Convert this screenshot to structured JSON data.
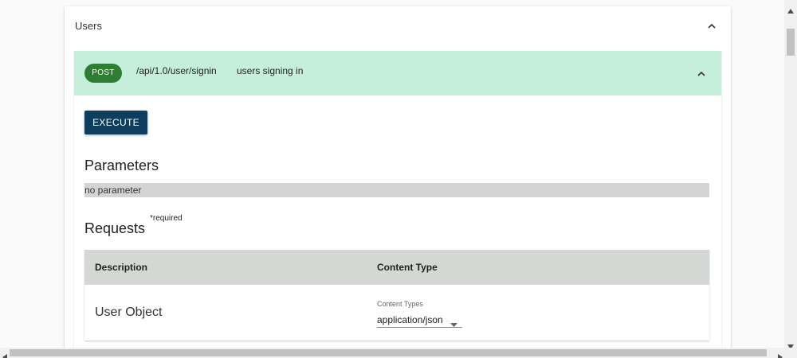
{
  "tag": {
    "title": "Users",
    "chevron_icon": "chevron-up-icon"
  },
  "operation": {
    "method": "POST",
    "path": "/api/1.0/user/signin",
    "summary": "users signing in",
    "method_color": "#2e7d32",
    "summary_background": "#c5eedb",
    "execute_label": "EXECUTE",
    "execute_color": "#0e3e5e"
  },
  "parameters": {
    "title": "Parameters",
    "empty_text": "no parameter"
  },
  "requests": {
    "title": "Requests",
    "required_note": "*required",
    "columns": [
      "Description",
      "Content Type"
    ],
    "rows": [
      {
        "description": "User Object",
        "content_type_label": "Content Types",
        "content_type_value": "application/json"
      }
    ]
  },
  "scrollbars": {
    "up_icon": "scroll-up-arrow-icon",
    "down_icon": "scroll-down-arrow-icon",
    "left_icon": "scroll-left-arrow-icon",
    "right_icon": "scroll-right-arrow-icon"
  }
}
